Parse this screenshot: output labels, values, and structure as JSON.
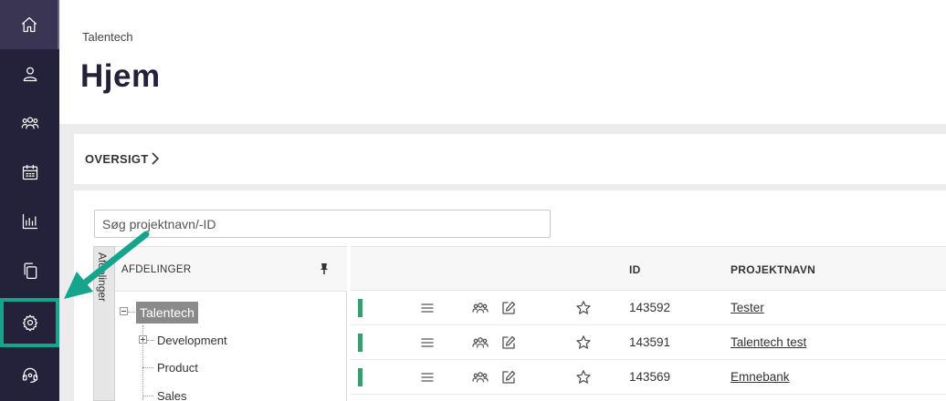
{
  "sidebar": {
    "items": [
      {
        "name": "home",
        "icon": "home-icon",
        "active": true
      },
      {
        "name": "user",
        "icon": "user-icon"
      },
      {
        "name": "groups",
        "icon": "group-icon"
      },
      {
        "name": "calendar",
        "icon": "calendar-icon"
      },
      {
        "name": "reports",
        "icon": "chart-icon"
      },
      {
        "name": "documents",
        "icon": "copy-icon"
      },
      {
        "name": "settings",
        "icon": "gear-icon",
        "highlighted": true
      },
      {
        "name": "support",
        "icon": "headset-icon"
      }
    ]
  },
  "header": {
    "breadcrumb": "Talentech",
    "title": "Hjem"
  },
  "overview": {
    "label": "OVERSIGT"
  },
  "search": {
    "placeholder": "Søg projektnavn/-ID"
  },
  "departments": {
    "vertical_tab": "Afdelinger",
    "title": "AFDELINGER",
    "tree": [
      {
        "label": "Talentech",
        "level": 0,
        "selected": true
      },
      {
        "label": "Development",
        "level": 1,
        "expandable": true
      },
      {
        "label": "Product",
        "level": 1
      },
      {
        "label": "Sales",
        "level": 1
      }
    ]
  },
  "table": {
    "columns": [
      "ID",
      "PROJEKTNAVN"
    ],
    "rows": [
      {
        "id": "143592",
        "name": "Tester"
      },
      {
        "id": "143591",
        "name": "Talentech test"
      },
      {
        "id": "143569",
        "name": "Emnebank"
      }
    ]
  },
  "colors": {
    "sidebar_bg": "#23223a",
    "annotation_arrow": "#15a58c",
    "status_green": "#3d9b6f"
  }
}
